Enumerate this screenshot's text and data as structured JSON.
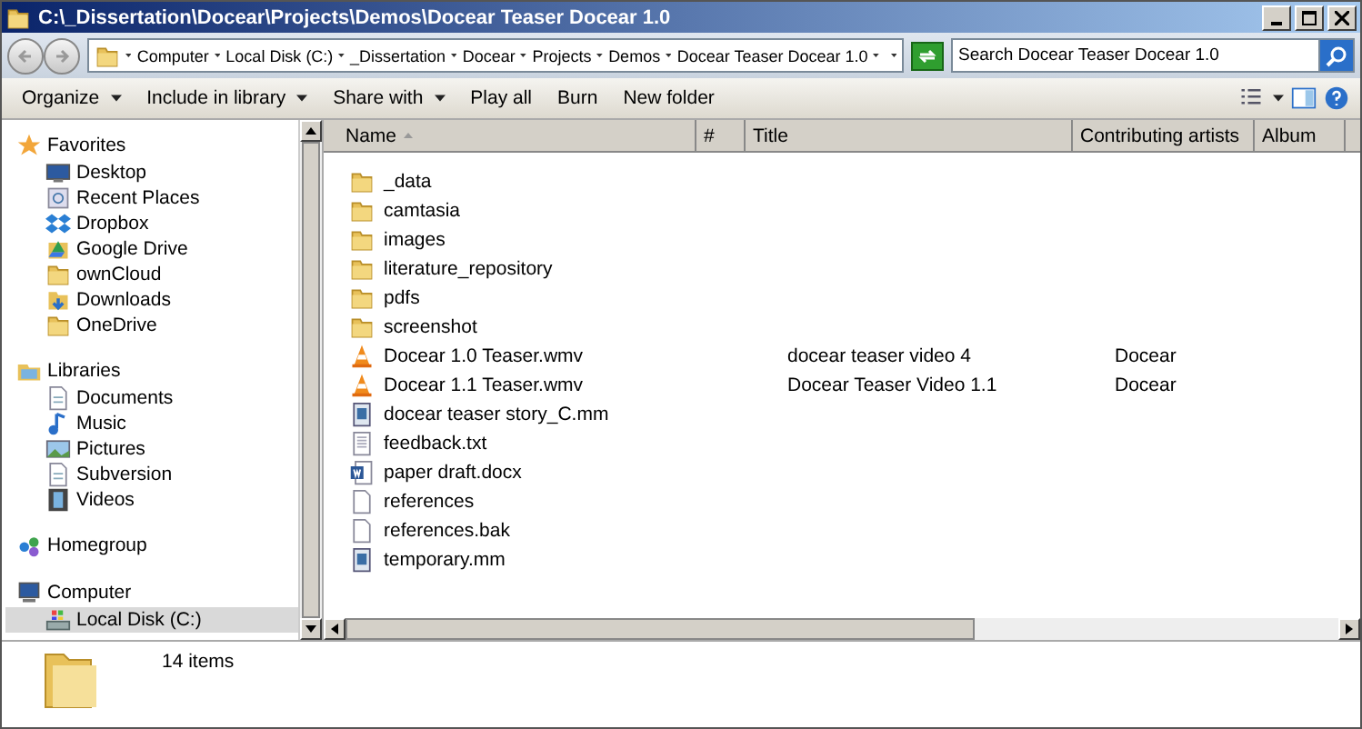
{
  "window": {
    "title": "C:\\_Dissertation\\Docear\\Projects\\Demos\\Docear Teaser Docear 1.0"
  },
  "address": {
    "segments": [
      "Computer",
      "Local Disk (C:)",
      "_Dissertation",
      "Docear",
      "Projects",
      "Demos",
      "Docear Teaser Docear 1.0"
    ]
  },
  "search": {
    "placeholder": "Search Docear Teaser Docear 1.0"
  },
  "toolbar": [
    {
      "label": "Organize",
      "kind": "menu"
    },
    {
      "label": "Include in library",
      "kind": "menu"
    },
    {
      "label": "Share with",
      "kind": "menu"
    },
    {
      "label": "Play all",
      "kind": "plain"
    },
    {
      "label": "Burn",
      "kind": "plain"
    },
    {
      "label": "New folder",
      "kind": "plain"
    }
  ],
  "sidebar": {
    "groups": [
      {
        "label": "Favorites",
        "items": [
          {
            "label": "Desktop",
            "selected": false
          },
          {
            "label": "Recent Places",
            "selected": false
          },
          {
            "label": "Dropbox",
            "selected": false
          },
          {
            "label": "Google Drive",
            "selected": false
          },
          {
            "label": "ownCloud",
            "selected": false
          },
          {
            "label": "Downloads",
            "selected": false
          },
          {
            "label": "OneDrive",
            "selected": false
          }
        ]
      },
      {
        "label": "Libraries",
        "items": [
          {
            "label": "Documents",
            "selected": false
          },
          {
            "label": "Music",
            "selected": false
          },
          {
            "label": "Pictures",
            "selected": false
          },
          {
            "label": "Subversion",
            "selected": false
          },
          {
            "label": "Videos",
            "selected": false
          }
        ]
      },
      {
        "label": "Homegroup"
      },
      {
        "label": "Computer",
        "items": [
          {
            "label": "Local Disk (C:)",
            "selected": true
          }
        ]
      }
    ]
  },
  "table": {
    "columns": [
      "Name",
      "#",
      "Title",
      "Contributing artists",
      "Album"
    ],
    "rows": [
      {
        "name": "_data",
        "kind": "folder"
      },
      {
        "name": "camtasia",
        "kind": "folder"
      },
      {
        "name": "images",
        "kind": "folder"
      },
      {
        "name": "literature_repository",
        "kind": "folder"
      },
      {
        "name": "pdfs",
        "kind": "folder"
      },
      {
        "name": "screenshot",
        "kind": "folder"
      },
      {
        "name": "Docear 1.0 Teaser.wmv",
        "kind": "video",
        "title": "docear teaser video 4",
        "artists": "Docear"
      },
      {
        "name": "Docear 1.1 Teaser.wmv",
        "kind": "video",
        "title": "Docear Teaser Video 1.1",
        "artists": "Docear"
      },
      {
        "name": "docear teaser story_C.mm",
        "kind": "mindmap"
      },
      {
        "name": "feedback.txt",
        "kind": "text"
      },
      {
        "name": "paper draft.docx",
        "kind": "word"
      },
      {
        "name": "references",
        "kind": "blank"
      },
      {
        "name": "references.bak",
        "kind": "blank"
      },
      {
        "name": "temporary.mm",
        "kind": "mindmap"
      }
    ]
  },
  "status_bar": {
    "count": "14 items"
  }
}
